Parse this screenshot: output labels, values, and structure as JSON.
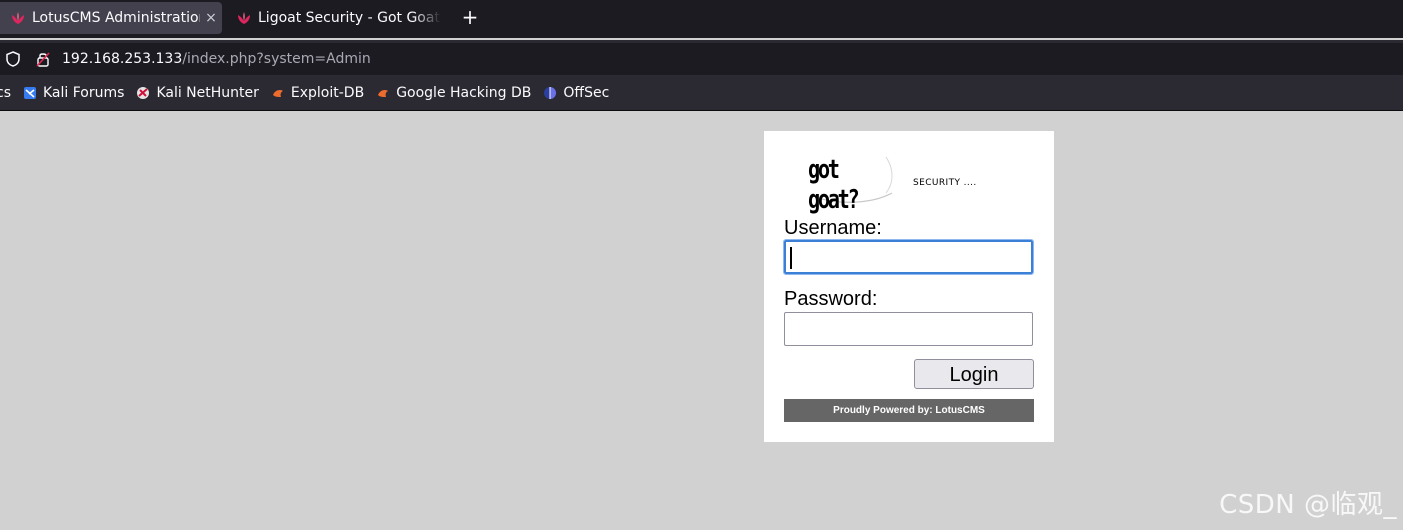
{
  "browser": {
    "tabs": [
      {
        "title": "LotusCMS Administration",
        "close": "×",
        "icon": "lotus-favicon-icon"
      },
      {
        "title": "Ligoat Security - Got Goat",
        "close": "×",
        "icon": "lotus-favicon-icon"
      }
    ],
    "new_tab": "+",
    "url": {
      "host": "192.168.253.133",
      "path": "/index.php?system=Admin"
    },
    "bookmarks": [
      {
        "label": "cs",
        "icon": ""
      },
      {
        "label": "Kali Forums",
        "icon": "kali-forums-icon"
      },
      {
        "label": "Kali NetHunter",
        "icon": "kali-nethunter-icon"
      },
      {
        "label": "Exploit-DB",
        "icon": "exploit-db-icon"
      },
      {
        "label": "Google Hacking DB",
        "icon": "exploit-db-icon"
      },
      {
        "label": "OffSec",
        "icon": "offsec-icon"
      }
    ]
  },
  "page": {
    "logo_text": "got goat?",
    "tagline": "SECURITY ....",
    "username_label": "Username:",
    "username_value": "",
    "password_label": "Password:",
    "password_value": "",
    "login_button": "Login",
    "footer": "Proudly Powered by: LotusCMS"
  },
  "watermark": "CSDN @临观_",
  "colors": {
    "tab_strip": "#1c1b22",
    "toolbar": "#2b2a33",
    "page_background": "#d1d1d1",
    "focus_ring": "#3b7fd6",
    "footer_bar": "#666666"
  }
}
